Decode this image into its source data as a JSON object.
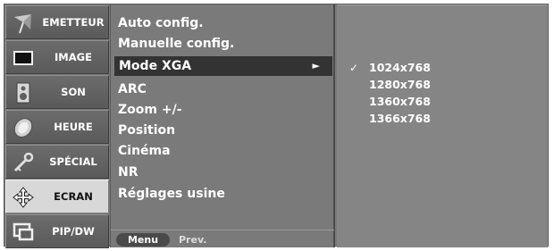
{
  "tabs": [
    {
      "label": "EMETTEUR",
      "icon": "antenna-icon"
    },
    {
      "label": "IMAGE",
      "icon": "screen-icon"
    },
    {
      "label": "SON",
      "icon": "speaker-icon"
    },
    {
      "label": "HEURE",
      "icon": "clock-icon"
    },
    {
      "label": "SPÉCIAL",
      "icon": "key-icon"
    },
    {
      "label": "ECRAN",
      "icon": "cursor-move-icon",
      "active": true
    },
    {
      "label": "PIP/DW",
      "icon": "pip-icon"
    }
  ],
  "menu": {
    "items": [
      {
        "label": "Auto config."
      },
      {
        "label": "Manuelle config."
      },
      {
        "label": "Mode XGA",
        "selected": true,
        "arrow": "►"
      },
      {
        "label": "ARC"
      },
      {
        "label": "Zoom +/-"
      },
      {
        "label": "Position"
      },
      {
        "label": "Cinéma"
      },
      {
        "label": "NR"
      },
      {
        "label": "Réglages usine"
      }
    ],
    "footer": {
      "button": "Menu",
      "hint": "Prev."
    }
  },
  "submenu": {
    "check_mark": "✓",
    "checked_index": 0,
    "options": [
      "1024x768",
      "1280x768",
      "1360x768",
      "1366x768"
    ]
  },
  "colors": {
    "panel": "#7a7a7a",
    "selected_row": "#333333",
    "active_tab": "#d8d8d8"
  }
}
